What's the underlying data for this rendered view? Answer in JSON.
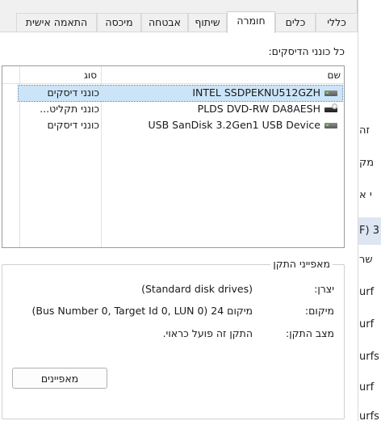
{
  "tabs": [
    {
      "label": "כללי",
      "active": false
    },
    {
      "label": "כלים",
      "active": false
    },
    {
      "label": "חומרה",
      "active": true
    },
    {
      "label": "שיתוף",
      "active": false
    },
    {
      "label": "אבטחה",
      "active": false
    },
    {
      "label": "מיכסה",
      "active": false
    },
    {
      "label": "התאמה אישית",
      "active": false
    }
  ],
  "section_label": "כל כונני הדיסקים:",
  "list": {
    "columns": {
      "name": "שם",
      "type": "סוג"
    },
    "rows": [
      {
        "name": "INTEL SSDPEKNU512GZH",
        "type": "כונני דיסקים",
        "icon": "hard-drive-icon",
        "selected": true
      },
      {
        "name": "PLDS DVD-RW DA8AESH",
        "type": "כונני תקליט...",
        "icon": "dvd-drive-icon",
        "selected": false
      },
      {
        "name": "USB  SanDisk 3.2Gen1 USB Device",
        "type": "כונני דיסקים",
        "icon": "hard-drive-icon",
        "selected": false
      }
    ]
  },
  "properties": {
    "title": "מאפייני התקן",
    "manufacturer_label": "יצרן:",
    "manufacturer_value": "(Standard disk drives)",
    "location_label": "מיקום:",
    "location_value": "מיקום 24 (Bus Number 0, Target Id 0, LUN 0)",
    "status_label": "מצב התקן:",
    "status_value": "התקן זה פועל כראוי.",
    "button_label": "מאפיינים"
  },
  "background_items": [
    "זה",
    "מק",
    "י א",
    "3 (F",
    "שר",
    "urf",
    "urf",
    "urfs",
    "urf",
    "urfs"
  ],
  "colors": {
    "selection": "#cce4f7",
    "dialog_bg": "#f0f0f0",
    "page_bg": "#ffffff"
  }
}
